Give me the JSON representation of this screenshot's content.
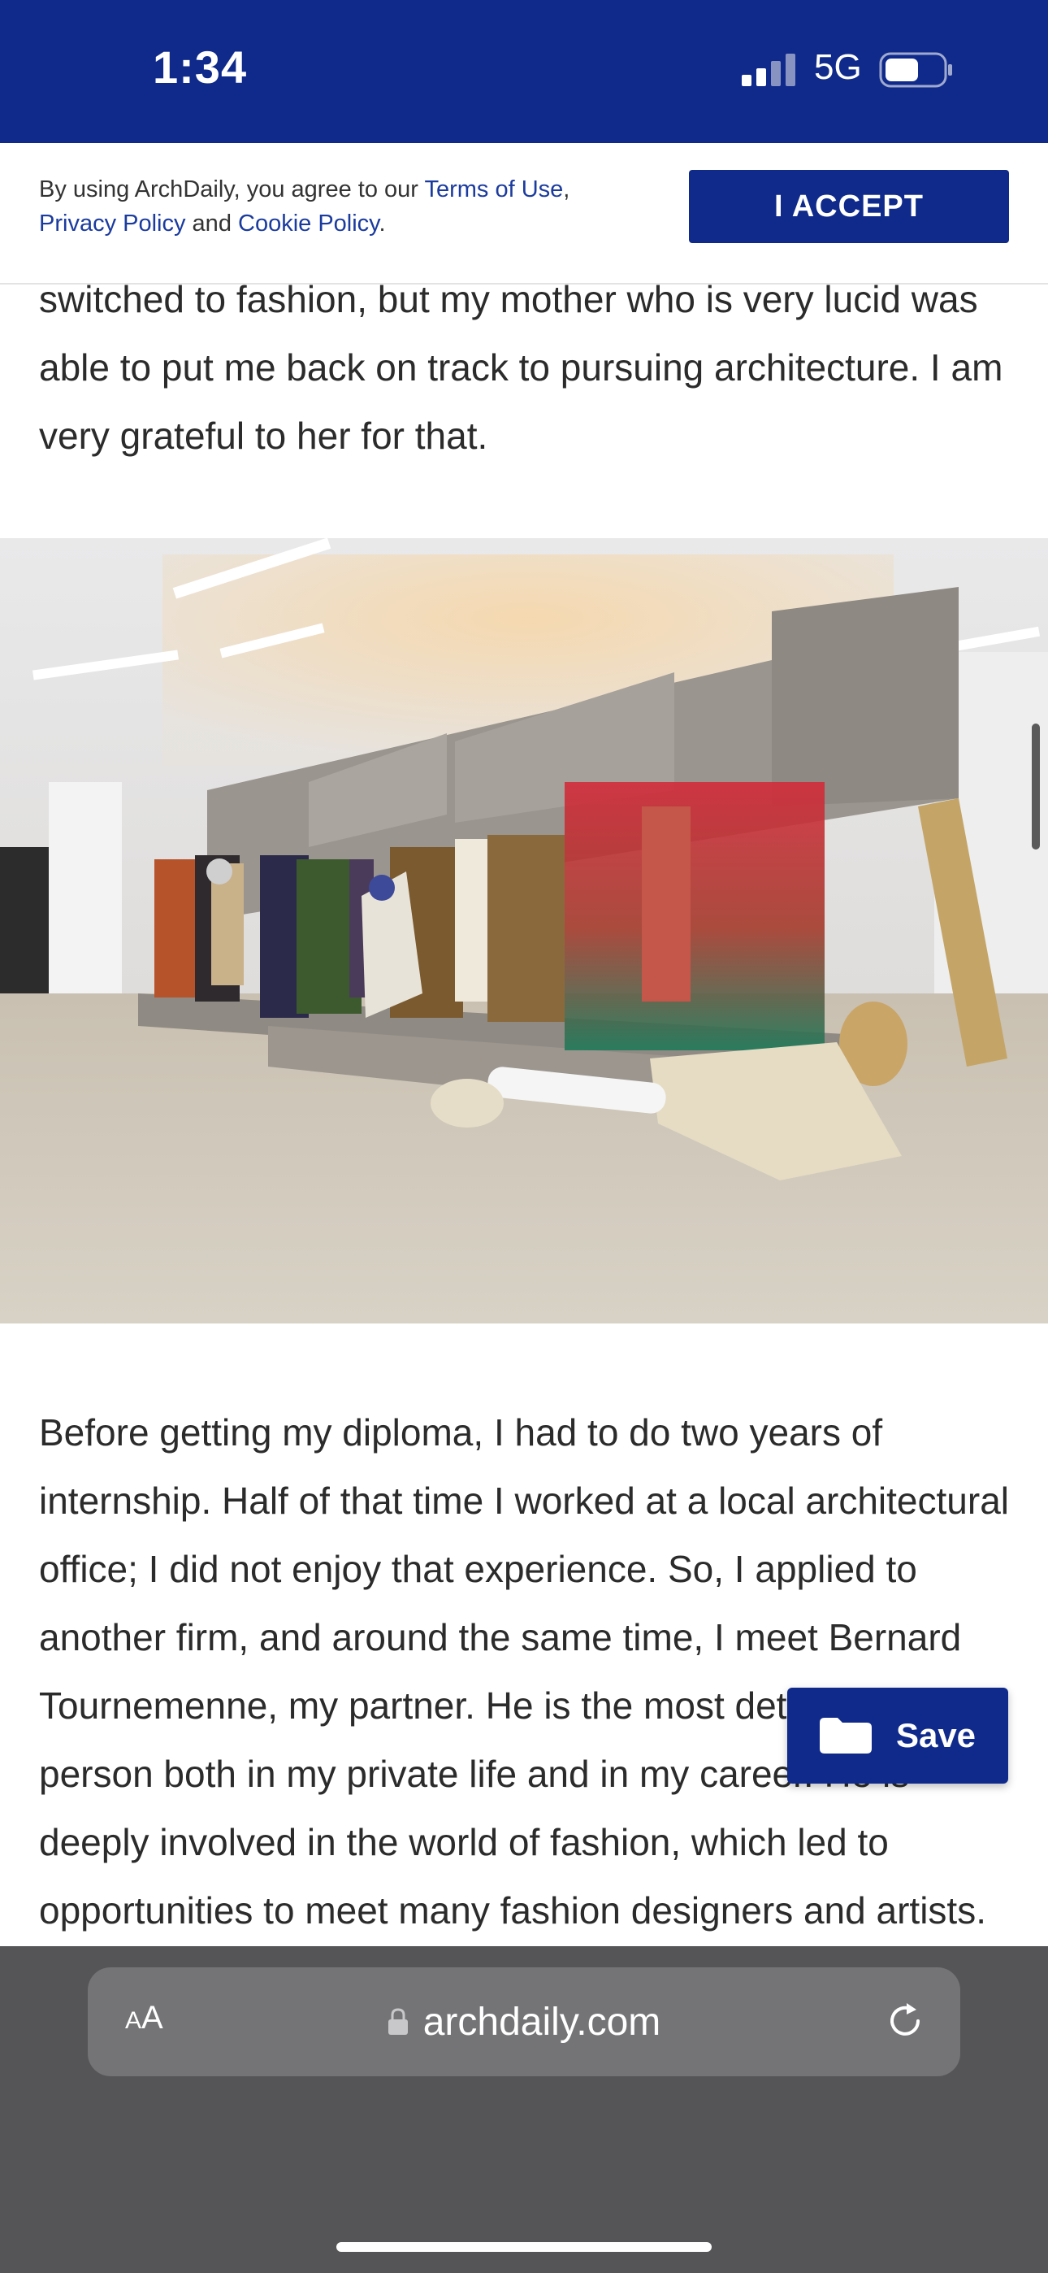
{
  "status_bar": {
    "time": "1:34",
    "network": "5G",
    "bg_color": "#0f2a8a"
  },
  "cookie_banner": {
    "text_prefix": "By using ArchDaily, you agree to our ",
    "terms_link": "Terms of Use",
    "separator": ", ",
    "privacy_link": "Privacy Policy",
    "middle": " and ",
    "cookie_link": "Cookie Policy",
    "suffix": ".",
    "accept_label": "I ACCEPT"
  },
  "article": {
    "paragraph_1": "switched to fashion, but my mother who is very lucid was able to put me back on track to pursuing architecture. I am very grateful to her for that.",
    "paragraph_2": "Before getting my diploma, I had to do two years of internship. Half of that time I worked at a local architectural office; I did not enjoy that experience. So, I applied to another firm, and around the same time, I meet Bernard Tournemenne, my partner. He is the most determined person both in my private life and in my career. He is deeply involved in the world of fashion, which led to opportunities to meet many fashion designers and artists. Then followed"
  },
  "save_button": {
    "label": "Save",
    "icon": "folder-icon"
  },
  "browser": {
    "text_size_label_small": "A",
    "text_size_label_large": "A",
    "url": "archdaily.com",
    "toolbar": [
      "back-icon",
      "forward-icon",
      "share-icon",
      "bookmarks-icon",
      "tabs-icon"
    ],
    "accent_color": "#3478f6"
  }
}
